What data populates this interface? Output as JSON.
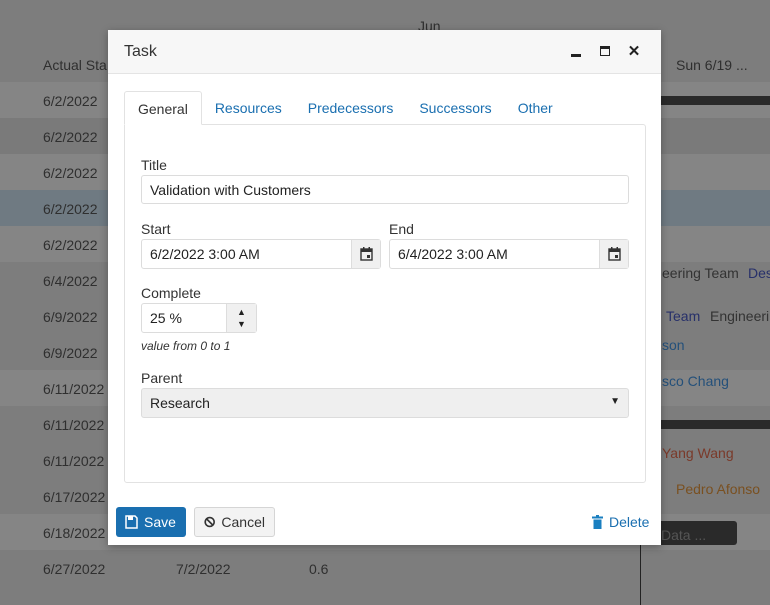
{
  "background": {
    "month_label": "Jun",
    "column_header": "Actual Sta",
    "day_header": "Sun 6/19 ...",
    "rows": [
      "6/2/2022",
      "6/2/2022",
      "6/2/2022",
      "6/2/2022",
      "6/2/2022",
      "6/4/2022",
      "6/9/2022",
      "6/9/2022",
      "6/11/2022",
      "6/11/2022",
      "6/11/2022",
      "6/17/2022",
      "6/18/2022",
      "6/27/2022"
    ],
    "last_row_end": "7/2/2022",
    "last_row_complete": "0.6",
    "resources": [
      "eering Team",
      "Des",
      "Team",
      "Engineeri",
      "son",
      "sco Chang",
      "Yang Wang",
      "Pedro Afonso"
    ],
    "task_bar": "Data ..."
  },
  "dialog": {
    "title": "Task",
    "tabs": [
      {
        "label": "General",
        "active": true
      },
      {
        "label": "Resources"
      },
      {
        "label": "Predecessors"
      },
      {
        "label": "Successors"
      },
      {
        "label": "Other"
      }
    ],
    "title_label": "Title",
    "title_value": "Validation with Customers",
    "start_label": "Start",
    "start_value": "6/2/2022 3:00 AM",
    "end_label": "End",
    "end_value": "6/4/2022 3:00 AM",
    "complete_label": "Complete",
    "complete_value": "25 %",
    "complete_hint": "value from 0 to 1",
    "parent_label": "Parent",
    "parent_value": "Research",
    "save_label": "Save",
    "cancel_label": "Cancel",
    "delete_label": "Delete",
    "accent": "#1a6fb0"
  }
}
